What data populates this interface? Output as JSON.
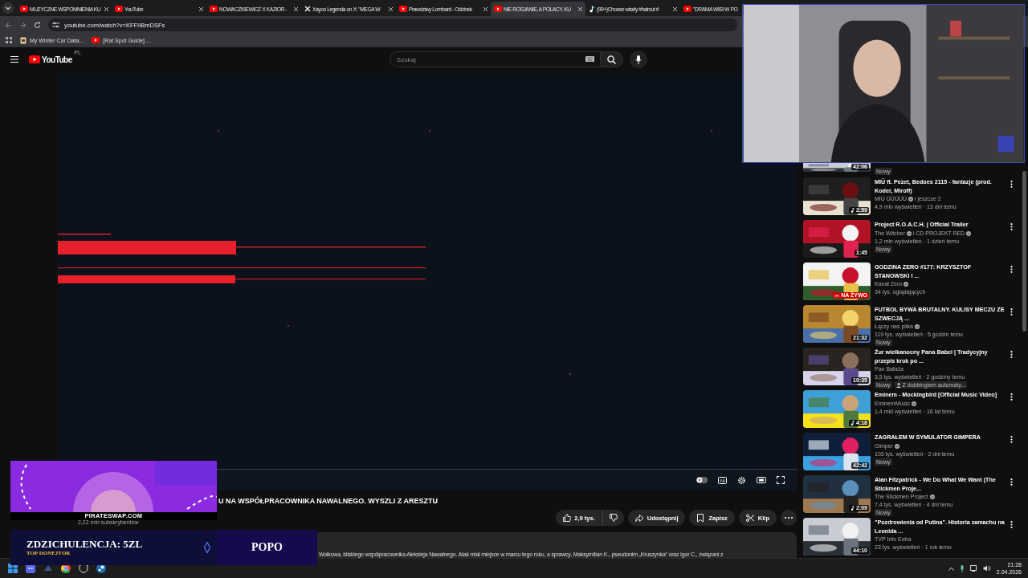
{
  "browser": {
    "tabs": [
      {
        "kind": "video",
        "title": "MUZYCZNE WSPOMNIENIA KU",
        "selected": false
      },
      {
        "kind": "video",
        "title": "YouTube",
        "selected": false
      },
      {
        "kind": "video",
        "title": "NOWACZKIEWICZ X KAZIOR - ",
        "selected": false
      },
      {
        "kind": "post",
        "title": "Xayoo Legenda on X: \"MEGA W",
        "selected": false
      },
      {
        "kind": "video",
        "title": "Prawdziwy Lombard - Odcinek",
        "selected": false
      },
      {
        "kind": "video",
        "title": "NIE ROSJANIE, A POLACY. KU",
        "selected": true
      },
      {
        "kind": "clip",
        "title": "(99+)Choose wisely #haircut #",
        "selected": false
      },
      {
        "kind": "video",
        "title": "\"DRAMA WISI W PO",
        "selected": false
      }
    ],
    "address": "youtube.com/watch?v=KFFIIBmDSFs",
    "bookmarks": [
      {
        "kind": "page",
        "label": "My Winter Car Data..."
      },
      {
        "kind": "video",
        "label": "[Rat Spot Guide] ..."
      }
    ]
  },
  "header": {
    "logo": "YouTube",
    "region": "PL",
    "search_placeholder": "Szukaj"
  },
  "video": {
    "title": "U NA WSPÓŁPRACOWNIKA NAWALNEGO. WYSZLI Z ARESZTU",
    "subscribers": "2,22 mln subskrybentów",
    "likes": "2,9 tys.",
    "actions": [
      "Udostępnij",
      "Zapisz",
      "Klip"
    ],
    "description": "Wołkowa, bliskiego współpracownika Aleksieja Nawalnego. Atak miał miejsce w marcu tego roku, a sprawcy, Maksymilian K., pseudonim „Kruszynka” oraz Igor C., związani z"
  },
  "recommendations": [
    {
      "kind": "partial",
      "duration": "42:06",
      "music": false,
      "badges": [
        {
          "kind": "new",
          "label": "Nowy"
        }
      ]
    },
    {
      "kind": "video",
      "title": "MIÜ ft. Pezet, Bedoes 2115 - fantazje (prod. Koder, Miroff)",
      "channel": "MIÜ ÜÜÜÜÜ",
      "verified": true,
      "co_channel": "i jeszcze 2",
      "co_verified": false,
      "stats": "4,9 mln wyświetleń · 13 dni temu",
      "duration": "2:59",
      "music": true
    },
    {
      "kind": "video",
      "title": "Project R.O.A.C.H. | Official Trailer",
      "channel": "The Witcher",
      "verified": true,
      "co_channel": "i CD PROJEKT RED",
      "co_verified": true,
      "stats": "1,2 mln wyświetleń · 1 dzień temu",
      "duration": "1:45",
      "music": false,
      "badges": [
        {
          "kind": "new",
          "label": "Nowy"
        }
      ]
    },
    {
      "kind": "video",
      "title": "GODZINA ZERO #177: KRZYSZTOF STANOWSKI I ...",
      "channel": "Kanał Zero",
      "verified": true,
      "stats": "34 tys. oglądających",
      "live_label": "NA ŻYWO"
    },
    {
      "kind": "video",
      "title": "FUTBOL BYWA BRUTALNY. KULISY MECZU ZE SZWECJĄ ...",
      "channel": "Łączy nas piłka",
      "verified": true,
      "stats": "119 tys. wyświetleń · 5 godzin temu",
      "duration": "21:32",
      "music": false,
      "badges": [
        {
          "kind": "new",
          "label": "Nowy"
        }
      ]
    },
    {
      "kind": "video",
      "title": "Żur wielkanocny Pana Babci | Tradycyjny przepis krok po ...",
      "channel": "Pan Babcia",
      "verified": false,
      "stats": "3,5 tys. wyświetleń · 2 godziny temu",
      "duration": "10:35",
      "music": false,
      "badges": [
        {
          "kind": "new",
          "label": "Nowy"
        },
        {
          "kind": "dubbed",
          "label": "Z dubbingiem automaty..."
        }
      ]
    },
    {
      "kind": "video",
      "title": "Eminem - Mockingbird [Official Music Video]",
      "channel": "EminemMusic",
      "verified": true,
      "stats": "1,4 mld wyświetleń · 16 lat temu",
      "duration": "4:18",
      "music": true
    },
    {
      "kind": "video",
      "title": "ZAGRAŁEM W SYMULATOR GIMPERA",
      "channel": "Gimper",
      "verified": true,
      "stats": "103 tys. wyświetleń · 2 dni temu",
      "duration": "42:42",
      "music": false,
      "badges": [
        {
          "kind": "new",
          "label": "Nowy"
        }
      ]
    },
    {
      "kind": "video",
      "title": "Alan Fitzpatrick - We Do What We Want (The Stickmen Proje...",
      "channel": "The Stickmen Project",
      "verified": true,
      "stats": "7,4 tys. wyświetleń · 4 dni temu",
      "duration": "2:09",
      "music": true,
      "badges": [
        {
          "kind": "new",
          "label": "Nowy"
        }
      ]
    },
    {
      "kind": "video",
      "title": "\"Pozdrowienia od Putina\". Historia zamachu na Leonida ...",
      "channel": "TVP Info Extra",
      "verified": false,
      "stats": "23 tys. wyświetleń · 1 rok temu",
      "duration": "44:10",
      "music": false
    }
  ],
  "overlay": {
    "sponsor": "PIRATESWAP.COM",
    "donation": "ZDZICHULENCJA: 5ZL",
    "donation_label": "TOP DONEJTOR",
    "name": "POPO"
  },
  "taskbar": {
    "time": "21:28",
    "date": "2.04.2026"
  }
}
